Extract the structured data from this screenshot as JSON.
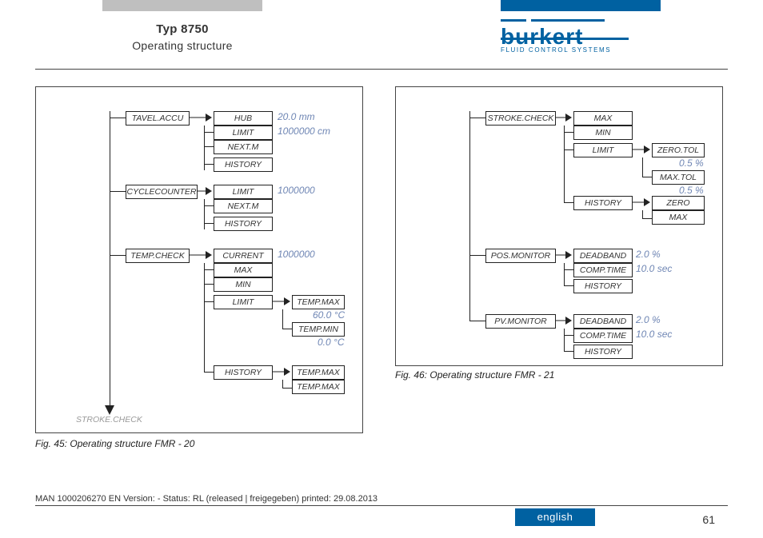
{
  "header": {
    "title_line1": "Typ 8750",
    "title_line2": "Operating structure"
  },
  "logo": {
    "name": "burkert",
    "tagline": "FLUID CONTROL SYSTEMS"
  },
  "fig45": {
    "caption": "Fig. 45:   Operating structure FMR - 20",
    "bottom_label": "STROKE.CHECK",
    "groups": [
      {
        "parent": "TAVEL.ACCU",
        "children": [
          "HUB",
          "LIMIT",
          "NEXT.M",
          "HISTORY"
        ],
        "values": [
          "20.0 mm",
          "1000000 cm"
        ]
      },
      {
        "parent": "CYCLECOUNTER",
        "children": [
          "LIMIT",
          "NEXT.M",
          "HISTORY"
        ],
        "values": [
          "1000000"
        ]
      },
      {
        "parent": "TEMP.CHECK",
        "children": [
          "CURRENT",
          "MAX",
          "MIN",
          "LIMIT"
        ],
        "values": [
          "1000000"
        ],
        "sub_limit": [
          "TEMP.MAX",
          "TEMP.MIN"
        ],
        "sub_limit_values": [
          "60.0 °C",
          "0.0 °C"
        ],
        "history": "HISTORY",
        "sub_history": [
          "TEMP.MAX",
          "TEMP.MAX"
        ]
      }
    ]
  },
  "fig46": {
    "caption": "Fig. 46:   Operating structure FMR - 21",
    "groups": [
      {
        "parent": "STROKE.CHECK",
        "children": [
          "MAX",
          "MIN",
          "LIMIT"
        ],
        "sub_limit": [
          "ZERO.TOL",
          "MAX.TOL"
        ],
        "sub_limit_values": [
          "0.5 %",
          "0.5 %"
        ],
        "history": "HISTORY",
        "sub_history": [
          "ZERO",
          "MAX"
        ]
      },
      {
        "parent": "POS.MONITOR",
        "children": [
          "DEADBAND",
          "COMP.TIME",
          "HISTORY"
        ],
        "values": [
          "2.0 %",
          "10.0 sec"
        ]
      },
      {
        "parent": "PV.MONITOR",
        "children": [
          "DEADBAND",
          "COMP.TIME",
          "HISTORY"
        ],
        "values": [
          "2.0 %",
          "10.0 sec"
        ]
      }
    ]
  },
  "footer": {
    "note": "MAN 1000206270 EN Version: - Status: RL (released | freigegeben)  printed: 29.08.2013",
    "page": "61",
    "language": "english"
  }
}
